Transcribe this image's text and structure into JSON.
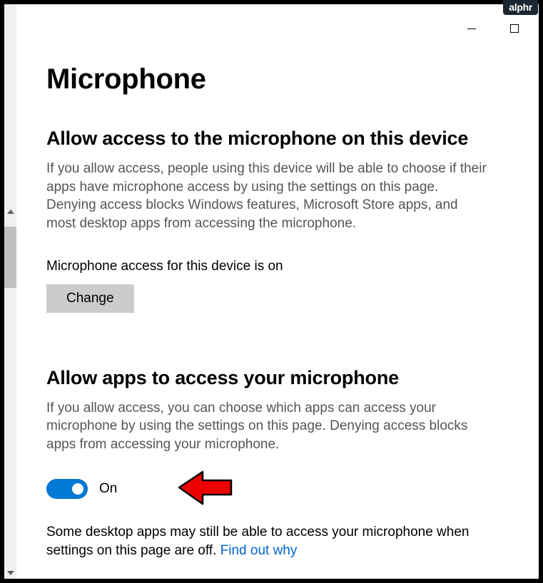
{
  "watermark": "alphr",
  "page": {
    "title": "Microphone"
  },
  "section1": {
    "heading": "Allow access to the microphone on this device",
    "description": "If you allow access, people using this device will be able to choose if their apps have microphone access by using the settings on this page. Denying access blocks Windows features, Microsoft Store apps, and most desktop apps from accessing the microphone.",
    "status": "Microphone access for this device is on",
    "changeButton": "Change"
  },
  "section2": {
    "heading": "Allow apps to access your microphone",
    "description": "If you allow access, you can choose which apps can access your microphone by using the settings on this page. Denying access blocks apps from accessing your microphone.",
    "toggleLabel": "On",
    "toggleState": true
  },
  "footer": {
    "text": "Some desktop apps may still be able to access your microphone when settings on this page are off. ",
    "linkText": "Find out why"
  }
}
